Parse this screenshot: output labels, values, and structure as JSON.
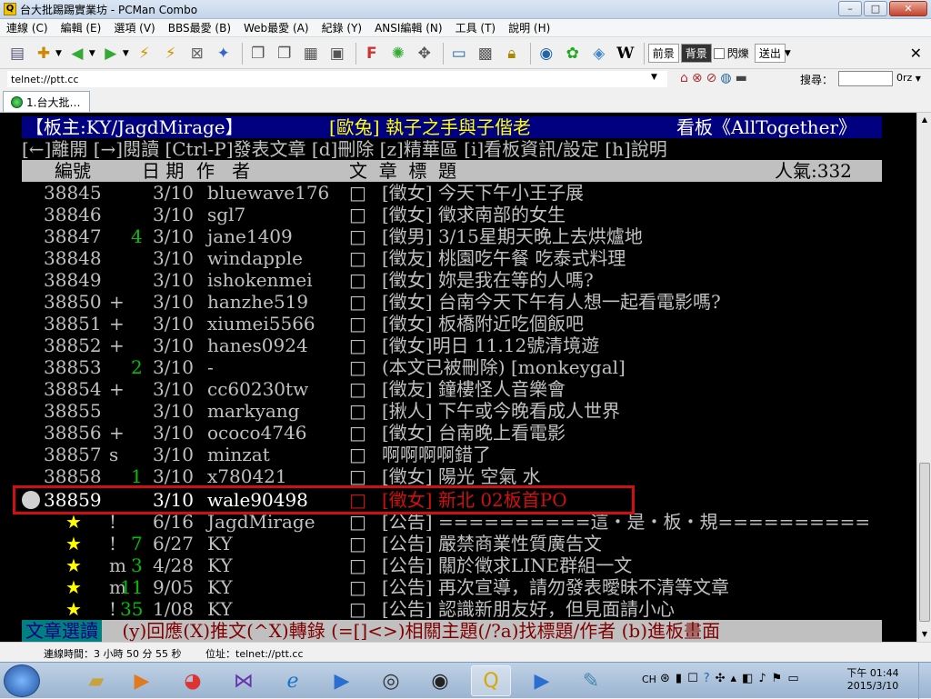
{
  "window": {
    "title": "台大批踢踢實業坊 - PCMan Combo",
    "min": "–",
    "max": "□",
    "close": "✕"
  },
  "menu": [
    "連線 (C)",
    "編輯 (E)",
    "選項 (V)",
    "BBS最愛 (B)",
    "Web最愛 (A)",
    "紀錄 (Y)",
    "ANSI編輯 (N)",
    "工具 (T)",
    "說明 (H)"
  ],
  "toolbar": {
    "prev_label": "前景",
    "bg_label": "背景",
    "blink_label": "閃爍",
    "send_label": "送出",
    "close_label": "✕"
  },
  "address": {
    "value": "telnet://ptt.cc",
    "search_label": "搜尋：",
    "search_engine": "0rz"
  },
  "tabs": [
    {
      "label": "1.台大批…"
    }
  ],
  "terminal": {
    "board_line": {
      "moderator": "【板主:KY/JagdMirage】",
      "title": "[歐兔] 執子之手與子偕老",
      "board": "看板《AllTogether》"
    },
    "help_line": "[←]離開 [→]閱讀 [Ctrl-P]發表文章 [d]刪除 [z]精華區 [i]看板資訊/設定 [h]說明",
    "header": {
      "num": "編號",
      "date": "日 期",
      "author": "作   者",
      "title": "文  章  標  題",
      "popularity": "人氣:332"
    },
    "rows": [
      {
        "num": "38845",
        "mark": " ",
        "push": "",
        "date": "3/10",
        "author": "bluewave176",
        "box": "□",
        "title": "[徵女] 今天下午小王子展"
      },
      {
        "num": "38846",
        "mark": " ",
        "push": "",
        "date": "3/10",
        "author": "sgl7",
        "box": "□",
        "title": "[徵女] 徵求南部的女生"
      },
      {
        "num": "38847",
        "mark": " ",
        "push": "4",
        "date": "3/10",
        "author": "jane1409",
        "box": "□",
        "title": "[徵男] 3/15星期天晚上去烘爐地"
      },
      {
        "num": "38848",
        "mark": " ",
        "push": "",
        "date": "3/10",
        "author": "windapple",
        "box": "□",
        "title": "[徵友] 桃園吃午餐 吃泰式料理"
      },
      {
        "num": "38849",
        "mark": " ",
        "push": "",
        "date": "3/10",
        "author": "ishokenmei",
        "box": "□",
        "title": "[徵女] 妳是我在等的人嗎?"
      },
      {
        "num": "38850",
        "mark": "+",
        "push": "",
        "date": "3/10",
        "author": "hanzhe519",
        "box": "□",
        "title": "[徵女] 台南今天下午有人想一起看電影嗎?"
      },
      {
        "num": "38851",
        "mark": "+",
        "push": "",
        "date": "3/10",
        "author": "xiumei5566",
        "box": "□",
        "title": "[徵女] 板橋附近吃個飯吧"
      },
      {
        "num": "38852",
        "mark": "+",
        "push": "",
        "date": "3/10",
        "author": "hanes0924",
        "box": "□",
        "title": "[徵女]明日 11.12號清境遊"
      },
      {
        "num": "38853",
        "mark": " ",
        "push": "2",
        "date": "3/10",
        "author": "-",
        "box": "□",
        "title": "(本文已被刪除) [monkeygal]"
      },
      {
        "num": "38854",
        "mark": "+",
        "push": "",
        "date": "3/10",
        "author": "cc60230tw",
        "box": "□",
        "title": "[徵友] 鐘樓怪人音樂會"
      },
      {
        "num": "38855",
        "mark": " ",
        "push": "",
        "date": "3/10",
        "author": "markyang",
        "box": "□",
        "title": "[揪人] 下午或今晚看成人世界"
      },
      {
        "num": "38856",
        "mark": "+",
        "push": "",
        "date": "3/10",
        "author": "ococo4746",
        "box": "□",
        "title": "[徵女] 台南晚上看電影"
      },
      {
        "num": "38857",
        "mark": "s",
        "push": "",
        "date": "3/10",
        "author": "minzat",
        "box": "□",
        "title": "啊啊啊啊錯了"
      },
      {
        "num": "38858",
        "mark": " ",
        "push": "1",
        "date": "3/10",
        "author": "x780421",
        "box": "□",
        "title": "[徵女] 陽光 空氣 水"
      }
    ],
    "selected_row": {
      "num": "38859",
      "date": "3/10",
      "author": "wale90498",
      "box": "□",
      "title": "[徵女] 新北 02板首PO"
    },
    "pinned": [
      {
        "star": "★",
        "mark": "!",
        "push": "",
        "date": "6/16",
        "author": "JagdMirage",
        "box": "□",
        "title": "[公告] ==========這・是・板・規=========="
      },
      {
        "star": "★",
        "mark": "!",
        "push": "7",
        "date": "6/27",
        "author": "KY",
        "box": "□",
        "title": "[公告] 嚴禁商業性質廣告文"
      },
      {
        "star": "★",
        "mark": "m",
        "push": "3",
        "date": "4/28",
        "author": "KY",
        "box": "□",
        "title": "[公告] 關於徵求LINE群組一文"
      },
      {
        "star": "★",
        "mark": "m",
        "push": "11",
        "date": "9/05",
        "author": "KY",
        "box": "□",
        "title": "[公告] 再次宣導，請勿發表曖昧不清等文章"
      },
      {
        "star": "★",
        "mark": "!",
        "push": "35",
        "date": "1/08",
        "author": "KY",
        "box": "□",
        "title": "[公告] 認識新朋友好，但見面請小心"
      }
    ],
    "bottom": {
      "mode": "文章選讀",
      "help": " (y)回應(X)推文(^X)轉錄 (=[]<>)相關主題(/?a)找標題/作者 (b)進板畫面"
    }
  },
  "statusbar": {
    "conn_time": "連線時間：3 小時 50 分 55 秒",
    "address": "位址：telnet://ptt.cc"
  },
  "clock": {
    "time": "下午 01:44",
    "date": "2015/3/10"
  },
  "tray": {
    "lang": "CH"
  },
  "colors": {
    "push_green": "#00c000",
    "selected_red": "#d01010",
    "star_yellow": "#ffff00",
    "terminal_bg": "#000000",
    "terminal_fg": "#c0c0c0"
  }
}
